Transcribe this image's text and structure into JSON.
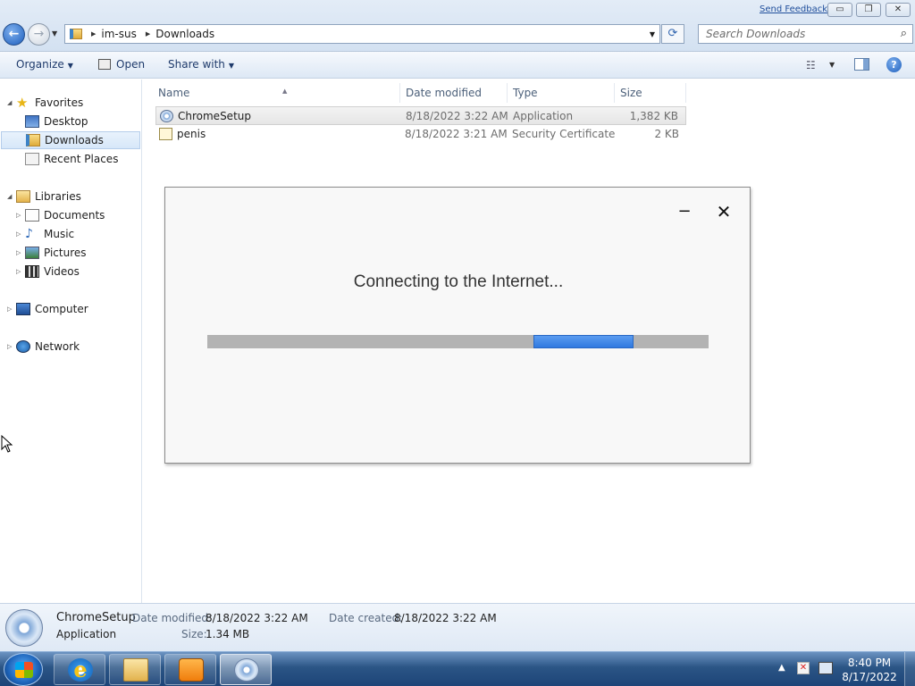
{
  "window": {
    "send_feedback": "Send Feedback",
    "minimize": "▭",
    "restore": "❐",
    "close": "✕"
  },
  "address": {
    "breadcrumbs": [
      "im-sus",
      "Downloads"
    ],
    "search_placeholder": "Search Downloads"
  },
  "toolbar": {
    "organize": "Organize",
    "open": "Open",
    "share_with": "Share with"
  },
  "navpane": {
    "favorites": "Favorites",
    "favorites_items": [
      "Desktop",
      "Downloads",
      "Recent Places"
    ],
    "libraries": "Libraries",
    "libraries_items": [
      "Documents",
      "Music",
      "Pictures",
      "Videos"
    ],
    "computer": "Computer",
    "network": "Network",
    "selected": "Downloads"
  },
  "filelist": {
    "columns": [
      "Name",
      "Date modified",
      "Type",
      "Size"
    ],
    "rows": [
      {
        "name": "ChromeSetup",
        "date": "8/18/2022 3:22 AM",
        "type": "Application",
        "size": "1,382 KB",
        "icon": "application-icon"
      },
      {
        "name": "penis",
        "date": "8/18/2022 3:21 AM",
        "type": "Security Certificate",
        "size": "2 KB",
        "icon": "certificate-icon"
      }
    ]
  },
  "dialog": {
    "message": "Connecting to the Internet...",
    "minimize": "−",
    "close": "✕",
    "progress": {
      "indeterminate": true,
      "fill_start": 0.65,
      "fill_end": 0.85
    }
  },
  "details": {
    "name": "ChromeSetup",
    "type": "Application",
    "date_modified_label": "Date modified:",
    "date_modified": "8/18/2022 3:22 AM",
    "date_created_label": "Date created:",
    "date_created": "8/18/2022 3:22 AM",
    "size_label": "Size:",
    "size": "1.34 MB"
  },
  "taskbar": {
    "time": "8:40 PM",
    "date": "8/17/2022",
    "tray_arrow": "▲",
    "apps": [
      "internet-explorer-icon",
      "windows-explorer-icon",
      "media-player-icon",
      "chrome-setup-icon"
    ]
  },
  "colors": {
    "progress_fill": "#2f79e0",
    "progress_track": "#b3b3b3",
    "link": "#1f4e9b"
  }
}
